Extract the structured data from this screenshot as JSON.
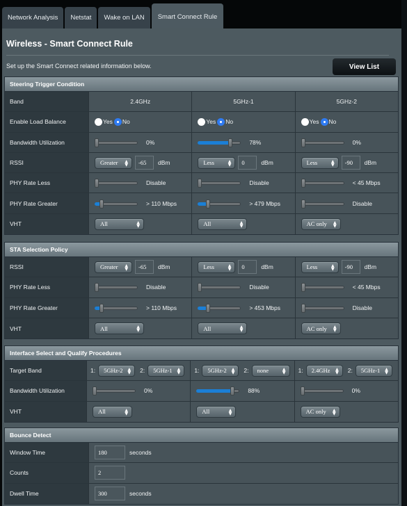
{
  "tabs": [
    {
      "label": "Network Analysis",
      "active": false
    },
    {
      "label": "Netstat",
      "active": false
    },
    {
      "label": "Wake on LAN",
      "active": false
    },
    {
      "label": "Smart Connect Rule",
      "active": true
    }
  ],
  "page": {
    "title": "Wireless - Smart Connect Rule",
    "description": "Set up the Smart Connect related information below.",
    "view_list_label": "View List"
  },
  "colors": {
    "accent": "#2f7bf2",
    "slider_fill": "#1b7fd6"
  },
  "steering": {
    "heading": "Steering Trigger Condition",
    "labels": {
      "band": "Band",
      "load_balance": "Enable Load Balance",
      "bandwidth": "Bandwidth Utilization",
      "rssi": "RSSI",
      "phy_less": "PHY Rate Less",
      "phy_greater": "PHY Rate Greater",
      "vht": "VHT"
    },
    "bands": [
      {
        "band": "2.4GHz",
        "yes_label": "Yes",
        "no_label": "No",
        "load_balance": "No",
        "bandwidth_pct": 0,
        "bandwidth_text": "0%",
        "rssi_op": "Greater",
        "rssi_value": "-65",
        "rssi_unit": "dBm",
        "phy_less_pos": 0,
        "phy_less_text": "Disable",
        "phy_greater_pos": 0.12,
        "phy_greater_text": "> 110 Mbps",
        "vht": "All"
      },
      {
        "band": "5GHz-1",
        "yes_label": "Yes",
        "no_label": "No",
        "load_balance": "No",
        "bandwidth_pct": 78,
        "bandwidth_text": "78%",
        "rssi_op": "Less",
        "rssi_value": "0",
        "rssi_unit": "dBm",
        "phy_less_pos": 0,
        "phy_less_text": "Disable",
        "phy_greater_pos": 0.22,
        "phy_greater_text": "> 479 Mbps",
        "vht": "All"
      },
      {
        "band": "5GHz-2",
        "yes_label": "Yes",
        "no_label": "No",
        "load_balance": "No",
        "bandwidth_pct": 0,
        "bandwidth_text": "0%",
        "rssi_op": "Less",
        "rssi_value": "-90",
        "rssi_unit": "dBm",
        "phy_less_pos": 0,
        "phy_less_text": "< 45 Mbps",
        "phy_greater_pos": 0,
        "phy_greater_text": "Disable",
        "vht": "AC only"
      }
    ]
  },
  "sta": {
    "heading": "STA Selection Policy",
    "labels": {
      "rssi": "RSSI",
      "phy_less": "PHY Rate Less",
      "phy_greater": "PHY Rate Greater",
      "vht": "VHT"
    },
    "bands": [
      {
        "rssi_op": "Greater",
        "rssi_value": "-65",
        "rssi_unit": "dBm",
        "phy_less_pos": 0,
        "phy_less_text": "Disable",
        "phy_greater_pos": 0.12,
        "phy_greater_text": "> 110 Mbps",
        "vht": "All"
      },
      {
        "rssi_op": "Less",
        "rssi_value": "0",
        "rssi_unit": "dBm",
        "phy_less_pos": 0,
        "phy_less_text": "Disable",
        "phy_greater_pos": 0.22,
        "phy_greater_text": "> 453 Mbps",
        "vht": "All"
      },
      {
        "rssi_op": "Less",
        "rssi_value": "-90",
        "rssi_unit": "dBm",
        "phy_less_pos": 0,
        "phy_less_text": "< 45 Mbps",
        "phy_greater_pos": 0,
        "phy_greater_text": "Disable",
        "vht": "AC only"
      }
    ]
  },
  "interface": {
    "heading": "Interface Select and Qualify Procedures",
    "labels": {
      "target_band": "Target Band",
      "bandwidth": "Bandwidth Utilization",
      "vht": "VHT"
    },
    "bands": [
      {
        "t1_label": "1:",
        "t1": "5GHz-2",
        "t2_label": "2:",
        "t2": "5GHz-1",
        "bandwidth_pct": 0,
        "bandwidth_text": "0%",
        "vht": "All"
      },
      {
        "t1_label": "1:",
        "t1": "5GHz-2",
        "t2_label": "2:",
        "t2": "none",
        "bandwidth_pct": 88,
        "bandwidth_text": "88%",
        "vht": "All"
      },
      {
        "t1_label": "1:",
        "t1": "2.4GHz",
        "t2_label": "2:",
        "t2": "5GHz-1",
        "bandwidth_pct": 0,
        "bandwidth_text": "0%",
        "vht": "AC only"
      }
    ]
  },
  "bounce": {
    "heading": "Bounce Detect",
    "window_label": "Window Time",
    "window_value": "180",
    "window_unit": "seconds",
    "counts_label": "Counts",
    "counts_value": "2",
    "dwell_label": "Dwell Time",
    "dwell_value": "300",
    "dwell_unit": "seconds"
  }
}
